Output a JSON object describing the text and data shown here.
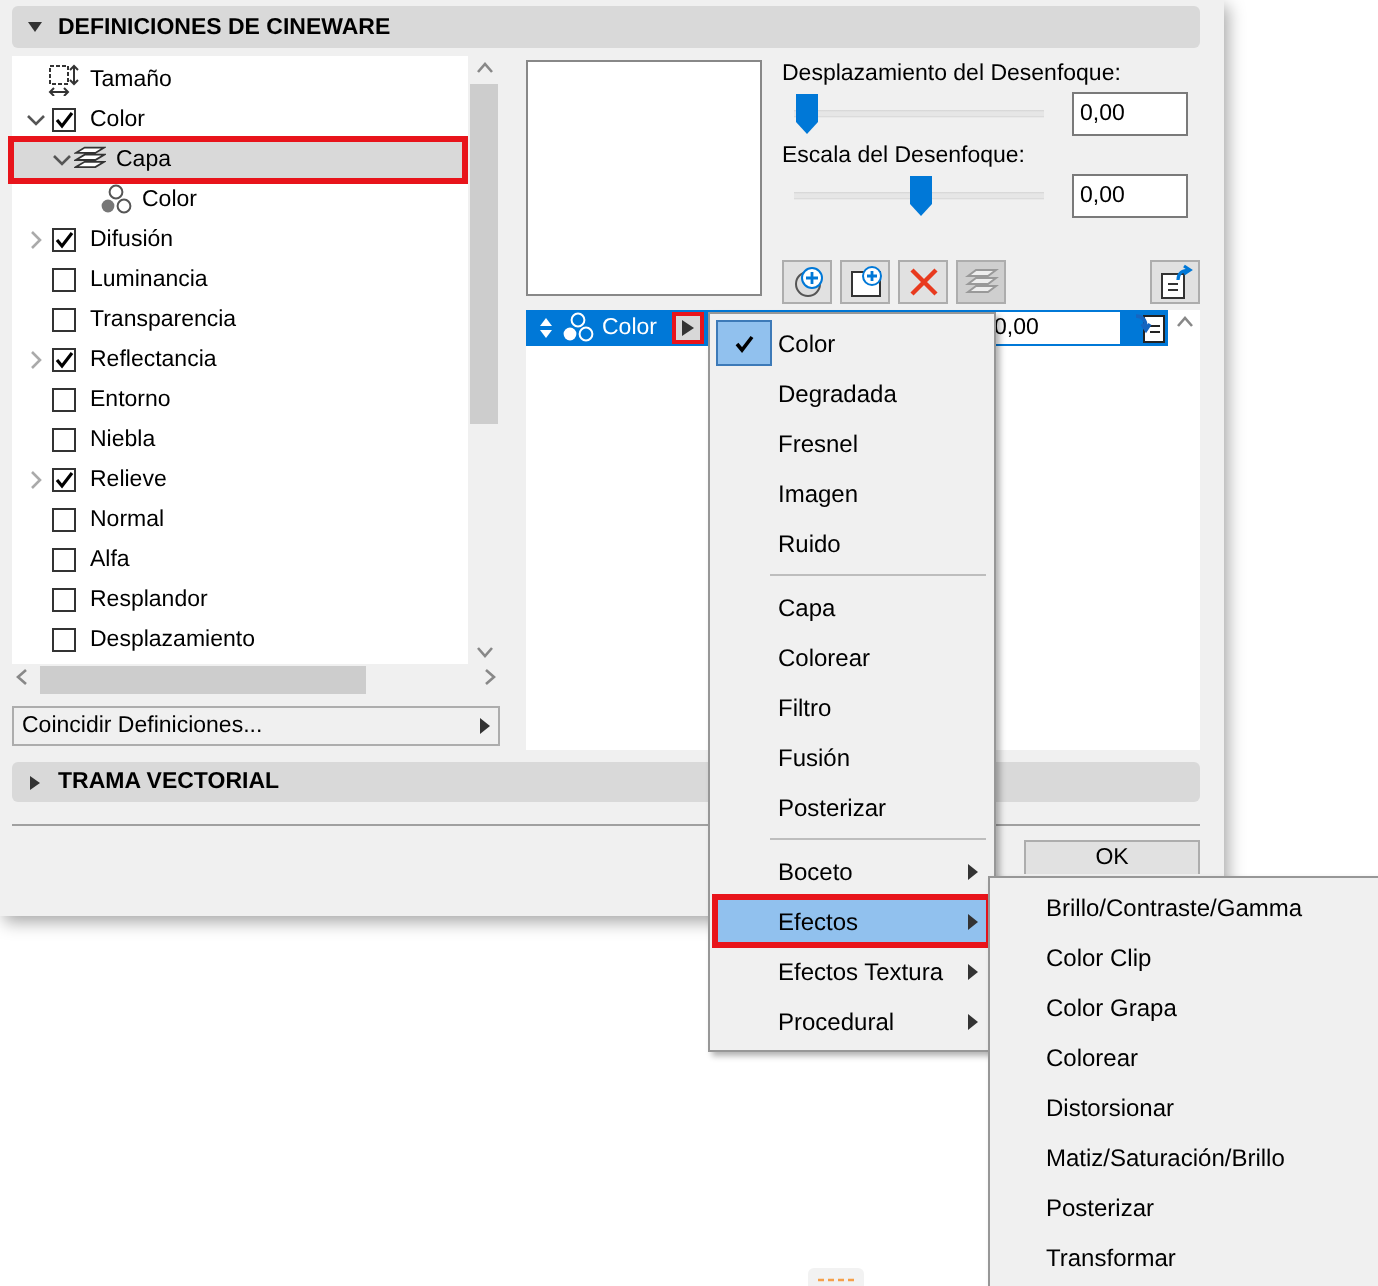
{
  "panel": {
    "title": "DEFINICIONES DE CINEWARE",
    "expanded": true
  },
  "tree": [
    {
      "label": "Tamaño",
      "kind": "size",
      "selected": false,
      "highlighted": false
    },
    {
      "label": "Color",
      "kind": "checkbox",
      "checked": true,
      "expanded": true,
      "selected": false,
      "highlighted": false,
      "children": [
        {
          "label": "Capa",
          "kind": "layer",
          "expanded": true,
          "selected": true,
          "highlighted": true,
          "children": [
            {
              "label": "Color",
              "kind": "shader",
              "selected": false,
              "highlighted": false
            }
          ]
        }
      ]
    },
    {
      "label": "Difusión",
      "kind": "checkbox",
      "checked": true,
      "expanded": false,
      "selected": false,
      "highlighted": false
    },
    {
      "label": "Luminancia",
      "kind": "checkbox",
      "checked": false,
      "selected": false,
      "highlighted": false
    },
    {
      "label": "Transparencia",
      "kind": "checkbox",
      "checked": false,
      "selected": false,
      "highlighted": false
    },
    {
      "label": "Reflectancia",
      "kind": "checkbox",
      "checked": true,
      "expanded": false,
      "selected": false,
      "highlighted": false
    },
    {
      "label": "Entorno",
      "kind": "checkbox",
      "checked": false,
      "selected": false,
      "highlighted": false
    },
    {
      "label": "Niebla",
      "kind": "checkbox",
      "checked": false,
      "selected": false,
      "highlighted": false
    },
    {
      "label": "Relieve",
      "kind": "checkbox",
      "checked": true,
      "expanded": false,
      "selected": false,
      "highlighted": false
    },
    {
      "label": "Normal",
      "kind": "checkbox",
      "checked": false,
      "selected": false,
      "highlighted": false
    },
    {
      "label": "Alfa",
      "kind": "checkbox",
      "checked": false,
      "selected": false,
      "highlighted": false
    },
    {
      "label": "Resplandor",
      "kind": "checkbox",
      "checked": false,
      "selected": false,
      "highlighted": false
    },
    {
      "label": "Desplazamiento",
      "kind": "checkbox",
      "checked": false,
      "selected": false,
      "highlighted": false
    }
  ],
  "match_button": {
    "label": "Coincidir Definiciones..."
  },
  "sliders": [
    {
      "label": "Desplazamiento del Desenfoque:",
      "level": 0.05,
      "value": "0,00"
    },
    {
      "label": "Escala del Desenfoque:",
      "level": 0.5,
      "value": "0,00"
    }
  ],
  "toolbar": [
    {
      "kind": "add-shader",
      "disabled": false
    },
    {
      "kind": "add-folder",
      "disabled": false
    },
    {
      "kind": "delete",
      "disabled": false
    },
    {
      "kind": "layers",
      "disabled": true
    },
    {
      "kind": "export",
      "disabled": false
    }
  ],
  "layer_rows": [
    {
      "label": "Color",
      "selected": true,
      "value": "0,00",
      "menu_button_highlighted": true
    }
  ],
  "section2": {
    "title": "TRAMA VECTORIAL",
    "expanded": false
  },
  "ok_button": {
    "label": "OK"
  },
  "context_menu": [
    {
      "kind": "item",
      "label": "Color",
      "checked": true,
      "selected": false,
      "highlighted": false
    },
    {
      "kind": "item",
      "label": "Degradada",
      "checked": false,
      "selected": false,
      "highlighted": false
    },
    {
      "kind": "item",
      "label": "Fresnel",
      "checked": false,
      "selected": false,
      "highlighted": false
    },
    {
      "kind": "item",
      "label": "Imagen",
      "checked": false,
      "selected": false,
      "highlighted": false
    },
    {
      "kind": "item",
      "label": "Ruido",
      "checked": false,
      "selected": false,
      "highlighted": false
    },
    {
      "kind": "separator"
    },
    {
      "kind": "item",
      "label": "Capa",
      "checked": false,
      "selected": false,
      "highlighted": false
    },
    {
      "kind": "item",
      "label": "Colorear",
      "checked": false,
      "selected": false,
      "highlighted": false
    },
    {
      "kind": "item",
      "label": "Filtro",
      "checked": false,
      "selected": false,
      "highlighted": false
    },
    {
      "kind": "item",
      "label": "Fusión",
      "checked": false,
      "selected": false,
      "highlighted": false
    },
    {
      "kind": "item",
      "label": "Posterizar",
      "checked": false,
      "selected": false,
      "highlighted": false
    },
    {
      "kind": "separator"
    },
    {
      "kind": "submenu",
      "label": "Boceto",
      "checked": false,
      "selected": false,
      "highlighted": false
    },
    {
      "kind": "submenu",
      "label": "Efectos",
      "checked": false,
      "selected": true,
      "highlighted": true
    },
    {
      "kind": "submenu",
      "label": "Efectos Textura",
      "checked": false,
      "selected": false,
      "highlighted": false
    },
    {
      "kind": "submenu",
      "label": "Procedural",
      "checked": false,
      "selected": false,
      "highlighted": false
    }
  ],
  "submenu": [
    {
      "kind": "item",
      "label": "Brillo/Contraste/Gamma"
    },
    {
      "kind": "item",
      "label": "Color Clip"
    },
    {
      "kind": "item",
      "label": "Color Grapa"
    },
    {
      "kind": "item",
      "label": "Colorear"
    },
    {
      "kind": "item",
      "label": "Distorsionar"
    },
    {
      "kind": "item",
      "label": "Matiz/Saturación/Brillo"
    },
    {
      "kind": "item",
      "label": "Posterizar"
    },
    {
      "kind": "item",
      "label": "Transformar"
    }
  ]
}
